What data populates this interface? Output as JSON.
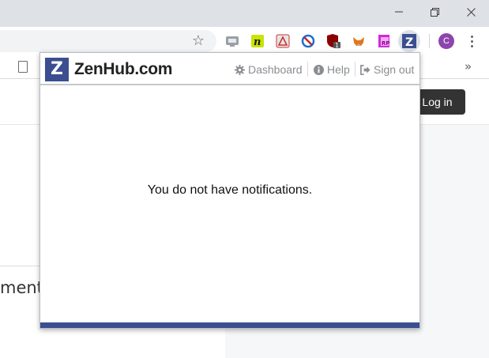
{
  "browser": {
    "avatar_initial": "C",
    "extensions": [
      "screen-capture-extension",
      "notion-extension",
      "pdf-extension",
      "block-extension",
      "ublock-extension",
      "metamask-extension",
      "rp-extension",
      "zenhub-extension"
    ],
    "ublock_badge": "1",
    "bookmarks_overflow": "»"
  },
  "page": {
    "login_label": "Log in",
    "partial_text": "ment"
  },
  "popup": {
    "logo_letter": "Z",
    "brand": "ZenHub.com",
    "nav": {
      "dashboard": "Dashboard",
      "help": "Help",
      "signout": "Sign out"
    },
    "empty_message": "You do not have notifications.",
    "accent_color": "#3b4e8f"
  }
}
